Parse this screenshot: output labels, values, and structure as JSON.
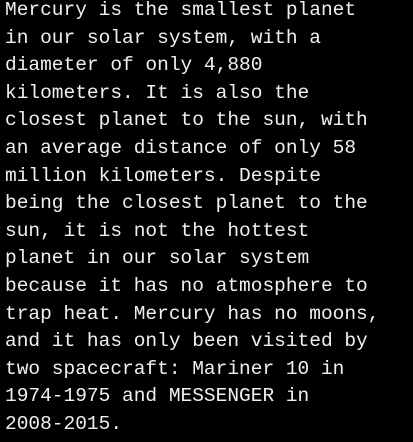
{
  "colors": {
    "background": "#000000",
    "text": "#f0f0f0"
  },
  "text_lines": [
    "Mercury is the smallest planet",
    "in our solar system, with a",
    "diameter of only 4,880",
    "kilometers. It is also the",
    "closest planet to the sun, with",
    "an average distance of only 58",
    "million kilometers. Despite",
    "being the closest planet to the",
    "sun, it is not the hottest",
    "planet in our solar system",
    "because it has no atmosphere to",
    "trap heat. Mercury has no moons,",
    "and it has only been visited by",
    "two spacecraft: Mariner 10 in",
    "1974-1975 and MESSENGER in",
    "2008-2015."
  ]
}
